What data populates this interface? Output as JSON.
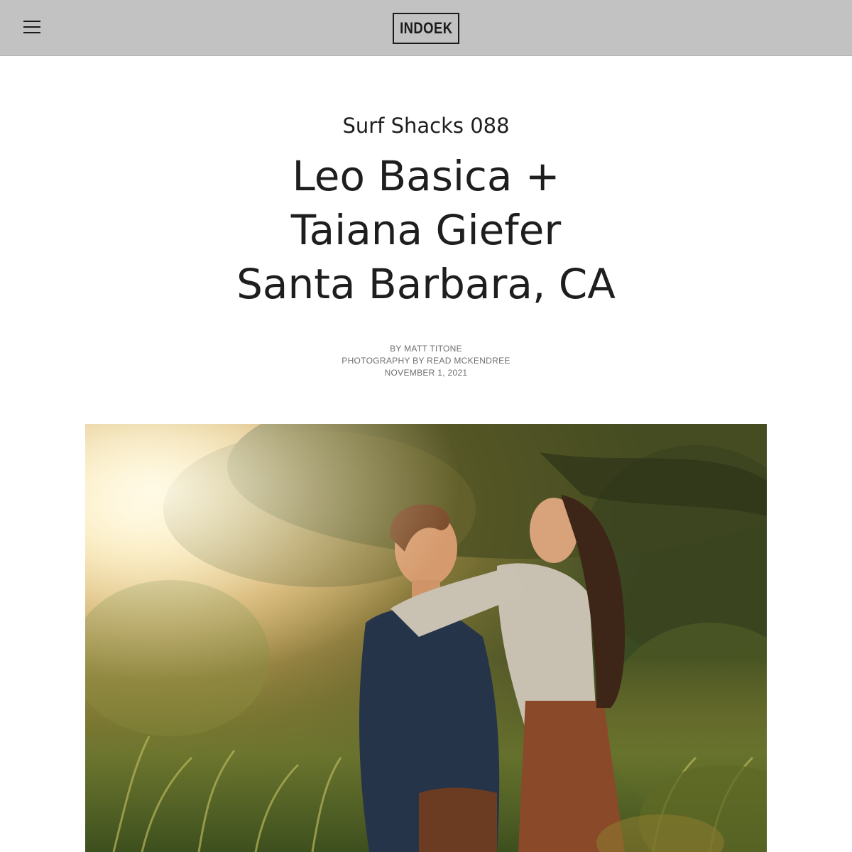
{
  "header": {
    "logo_text": "INDOEK",
    "menu_icon": "hamburger-menu-icon"
  },
  "article": {
    "kicker": "Surf Shacks 088",
    "title_lines": [
      "Leo Basica +",
      "Taiana Giefer",
      "Santa Barbara, CA"
    ],
    "byline": {
      "author": "BY MATT TITONE",
      "photography": "PHOTOGRAPHY BY READ MCKENDREE",
      "date": "NOVEMBER 1, 2021"
    }
  },
  "colors": {
    "header_bg": "#c2c2c2",
    "text": "#1e1e1e",
    "byline": "#6e6e6e"
  }
}
